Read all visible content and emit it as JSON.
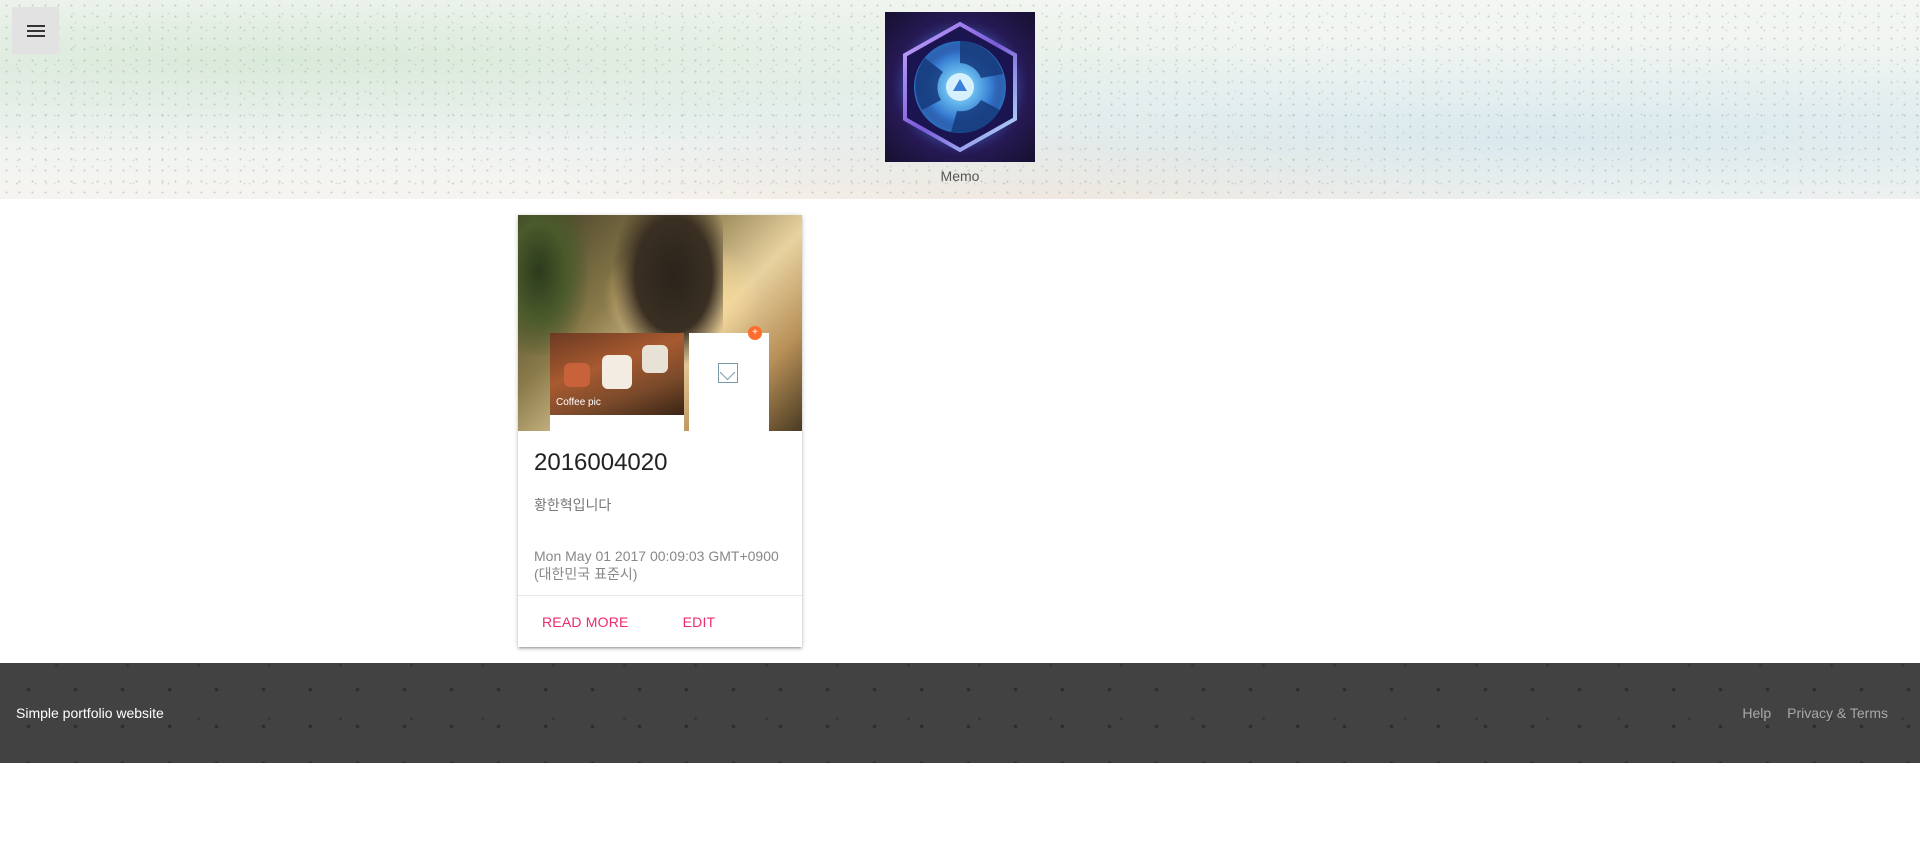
{
  "header": {
    "menu_icon": "hamburger-menu-icon",
    "logo_icon": "heroes-hexagon-logo-icon",
    "title": "Memo"
  },
  "card": {
    "image": {
      "caption": "Coffee pic",
      "badge": "+"
    },
    "title": "2016004020",
    "description": "황한혁입니다",
    "date": "Mon May 01 2017 00:09:03 GMT+0900 (대한민국 표준시)",
    "actions": {
      "read_more": "READ MORE",
      "edit": "EDIT"
    }
  },
  "footer": {
    "brand": "Simple portfolio website",
    "links": {
      "help": "Help",
      "privacy": "Privacy & Terms"
    }
  },
  "colors": {
    "accent": "#ee2a6f",
    "footer_bg": "#424242",
    "fab": "#ff6d2e"
  }
}
